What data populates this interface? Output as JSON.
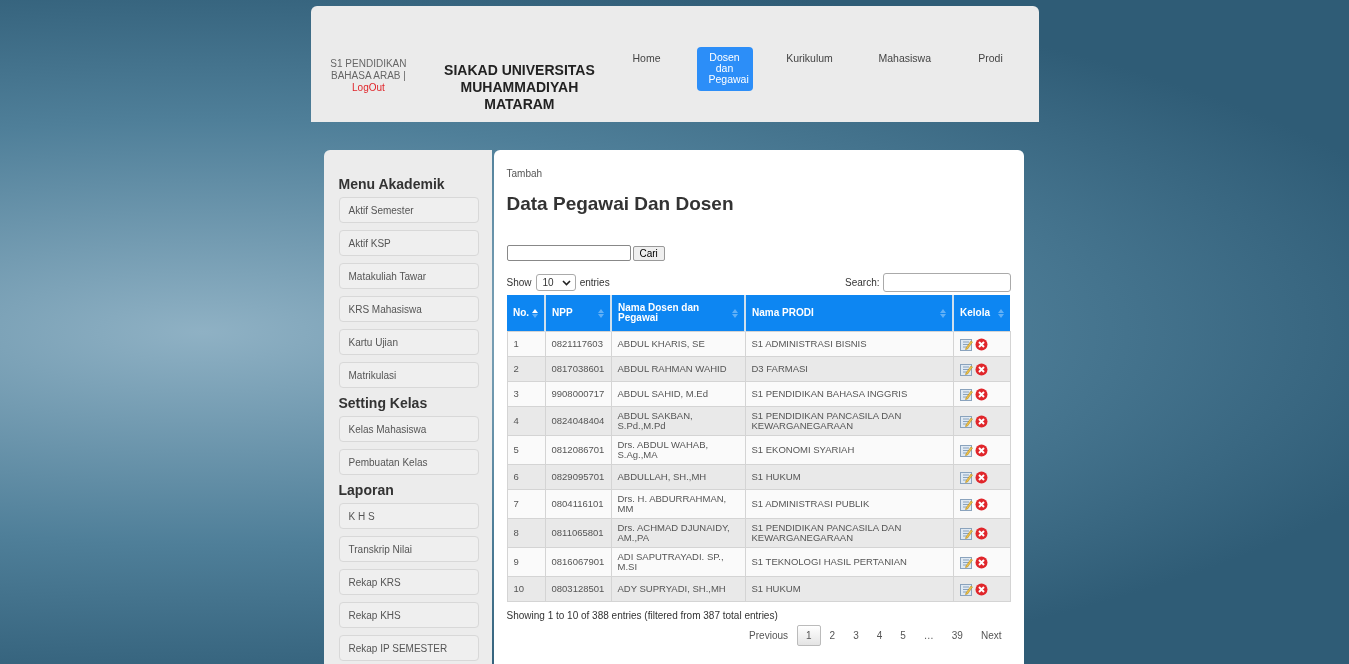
{
  "header": {
    "user": "S1 PENDIDIKAN BAHASA ARAB",
    "separator": "|",
    "logout": "LogOut",
    "title": "SIAKAD UNIVERSITAS MUHAMMADIYAH MATARAM",
    "nav": [
      {
        "label": "Home",
        "selected": false
      },
      {
        "label": "Dosen dan Pegawai",
        "selected": true
      },
      {
        "label": "Kurikulum",
        "selected": false
      },
      {
        "label": "Mahasiswa",
        "selected": false
      },
      {
        "label": "Prodi",
        "selected": false
      }
    ]
  },
  "sidebar": {
    "sections": [
      {
        "title": "Menu Akademik",
        "items": [
          "Aktif Semester",
          "Aktif KSP",
          "Matakuliah Tawar",
          "KRS Mahasiswa",
          "Kartu Ujian",
          "Matrikulasi"
        ]
      },
      {
        "title": "Setting Kelas",
        "items": [
          "Kelas Mahasiswa",
          "Pembuatan Kelas"
        ]
      },
      {
        "title": "Laporan",
        "items": [
          "K H S",
          "Transkrip Nilai",
          "Rekap KRS",
          "Rekap KHS",
          "Rekap IP SEMESTER"
        ]
      }
    ]
  },
  "content": {
    "add_link": "Tambah",
    "title": "Data Pegawai Dan Dosen",
    "search_button": "Cari",
    "length": {
      "show": "Show",
      "value": "10",
      "entries": "entries"
    },
    "search_label": "Search:",
    "table": {
      "columns": [
        {
          "label": "No.",
          "sorted": true
        },
        {
          "label": "NPP",
          "sorted": false
        },
        {
          "label": "Nama Dosen dan Pegawai",
          "sorted": false
        },
        {
          "label": "Nama PRODI",
          "sorted": false
        },
        {
          "label": "Kelola",
          "sorted": false
        }
      ],
      "rows": [
        [
          "1",
          "0821117603",
          "ABDUL KHARIS, SE",
          "S1 ADMINISTRASI BISNIS"
        ],
        [
          "2",
          "0817038601",
          "ABDUL RAHMAN WAHID",
          "D3 FARMASI"
        ],
        [
          "3",
          "9908000717",
          "ABDUL SAHID, M.Ed",
          "S1 PENDIDIKAN BAHASA INGGRIS"
        ],
        [
          "4",
          "0824048404",
          "ABDUL SAKBAN, S.Pd.,M.Pd",
          "S1 PENDIDIKAN PANCASILA DAN KEWARGANEGARAAN"
        ],
        [
          "5",
          "0812086701",
          "Drs. ABDUL WAHAB, S.Ag.,MA",
          "S1 EKONOMI SYARIAH"
        ],
        [
          "6",
          "0829095701",
          "ABDULLAH, SH.,MH",
          "S1 HUKUM"
        ],
        [
          "7",
          "0804116101",
          "Drs. H. ABDURRAHMAN, MM",
          "S1 ADMINISTRASI PUBLIK"
        ],
        [
          "8",
          "0811065801",
          "Drs. ACHMAD DJUNAIDY, AM.,PA",
          "S1 PENDIDIKAN PANCASILA DAN KEWARGANEGARAAN"
        ],
        [
          "9",
          "0816067901",
          "ADI SAPUTRAYADI. SP., M.SI",
          "S1 TEKNOLOGI HASIL PERTANIAN"
        ],
        [
          "10",
          "0803128501",
          "ADY SUPRYADI, SH.,MH",
          "S1 HUKUM"
        ]
      ]
    },
    "info": "Showing 1 to 10 of 388 entries (filtered from 387 total entries)",
    "pagination": {
      "previous": "Previous",
      "next": "Next",
      "pages": [
        {
          "label": "1",
          "selected": true
        },
        {
          "label": "2",
          "selected": false
        },
        {
          "label": "3",
          "selected": false
        },
        {
          "label": "4",
          "selected": false
        },
        {
          "label": "5",
          "selected": false
        },
        {
          "label": "…",
          "selected": false
        },
        {
          "label": "39",
          "selected": false
        }
      ]
    }
  }
}
